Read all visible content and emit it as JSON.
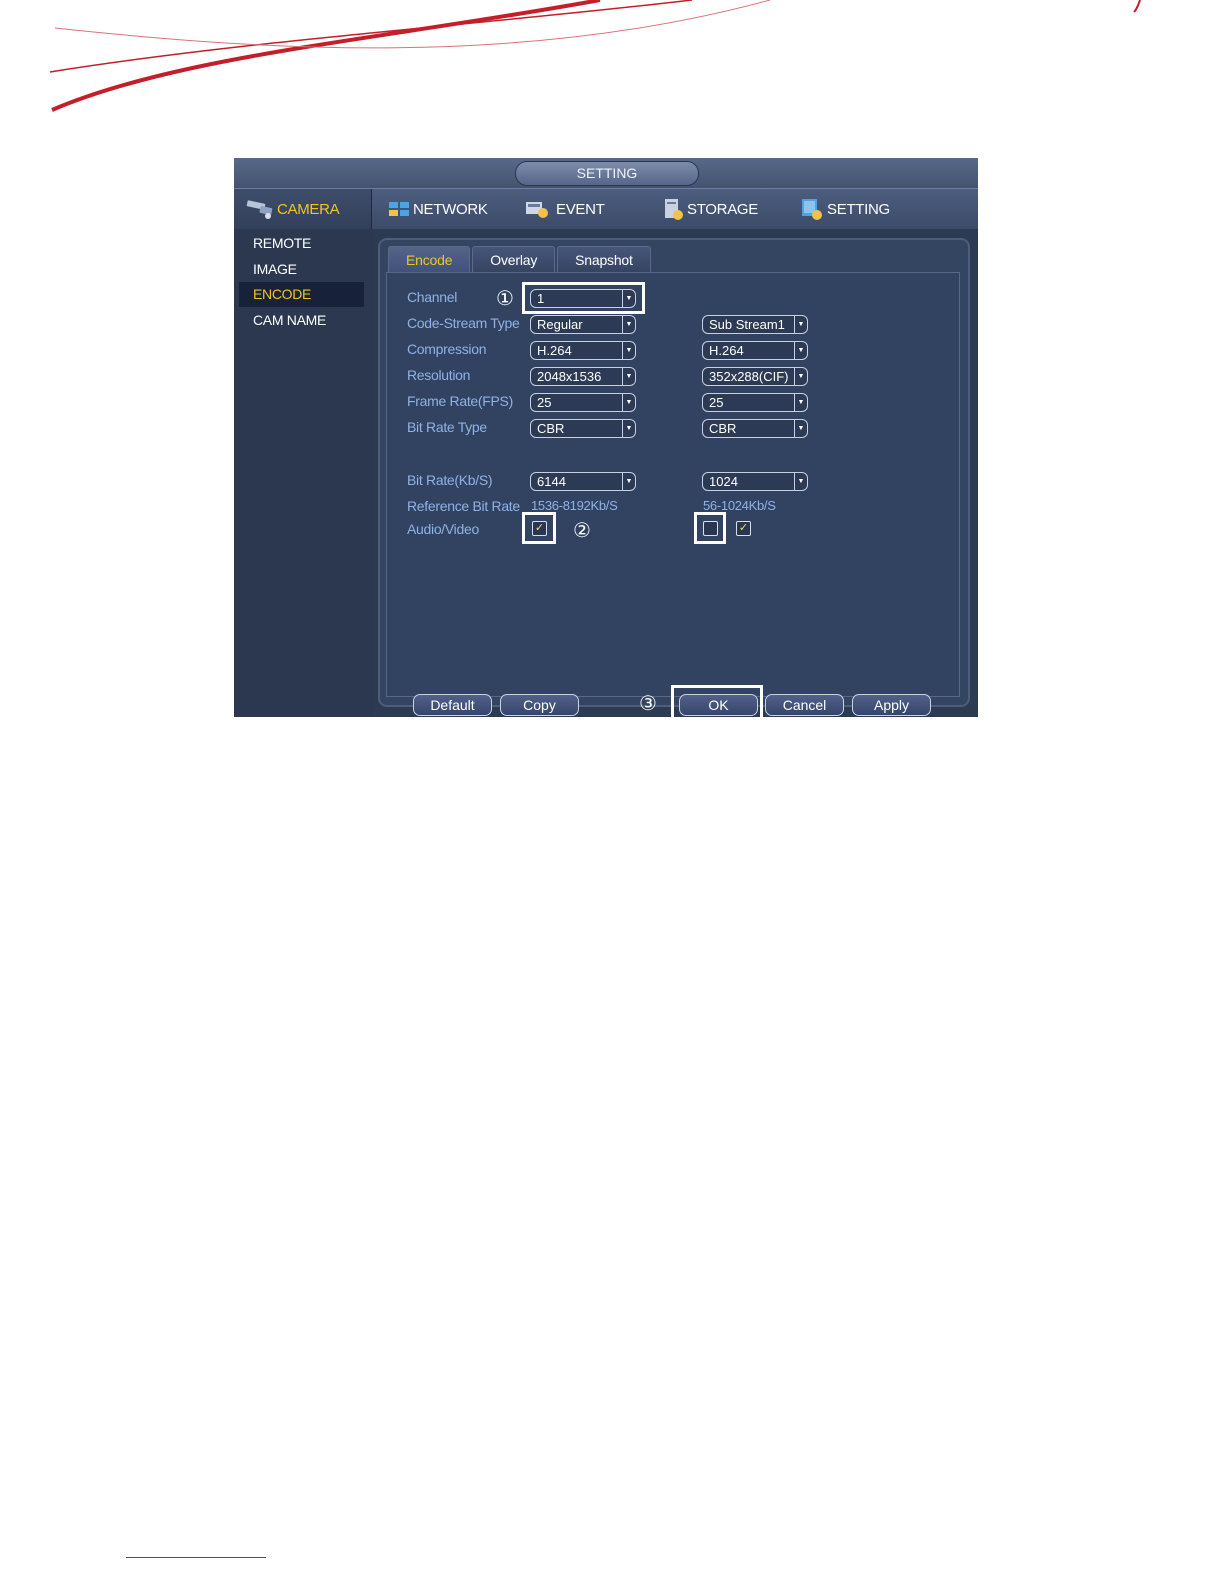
{
  "window": {
    "title": "SETTING"
  },
  "menubar": {
    "items": [
      {
        "label": "CAMERA",
        "icon": "camera-icon",
        "active": true
      },
      {
        "label": "NETWORK",
        "icon": "network-icon"
      },
      {
        "label": "EVENT",
        "icon": "event-icon"
      },
      {
        "label": "STORAGE",
        "icon": "storage-icon"
      },
      {
        "label": "SETTING",
        "icon": "setting-icon"
      }
    ]
  },
  "sidebar": {
    "items": [
      {
        "label": "REMOTE"
      },
      {
        "label": "IMAGE"
      },
      {
        "label": "ENCODE",
        "active": true
      },
      {
        "label": "CAM NAME"
      }
    ]
  },
  "tabs": [
    {
      "label": "Encode",
      "active": true
    },
    {
      "label": "Overlay"
    },
    {
      "label": "Snapshot"
    }
  ],
  "form": {
    "channel": {
      "label": "Channel",
      "value": "1"
    },
    "code_stream": {
      "label": "Code-Stream Type",
      "main": "Regular",
      "sub": "Sub Stream1"
    },
    "compression": {
      "label": "Compression",
      "main": "H.264",
      "sub": "H.264"
    },
    "resolution": {
      "label": "Resolution",
      "main": "2048x1536",
      "sub": "352x288(CIF)"
    },
    "frame_rate": {
      "label": "Frame Rate(FPS)",
      "main": "25",
      "sub": "25"
    },
    "bit_rate_type": {
      "label": "Bit Rate Type",
      "main": "CBR",
      "sub": "CBR"
    },
    "bit_rate": {
      "label": "Bit Rate(Kb/S)",
      "main": "6144",
      "sub": "1024"
    },
    "reference": {
      "label": "Reference Bit Rate",
      "main": "1536-8192Kb/S",
      "sub": "56-1024Kb/S"
    },
    "audio_video": {
      "label": "Audio/Video",
      "main_checked": true,
      "sub_audio_checked": false,
      "sub_video_checked": true
    }
  },
  "buttons": {
    "default": "Default",
    "copy": "Copy",
    "ok": "OK",
    "cancel": "Cancel",
    "apply": "Apply"
  },
  "callouts": {
    "c1": "①",
    "c2": "②",
    "c3": "③"
  },
  "glyphs": {
    "dropdown_arrow": "▼",
    "check": "✓"
  },
  "colors": {
    "accent": "#f3c51c",
    "label": "#8eb2e6",
    "brand_swoosh": "#c41e2a",
    "panel": "#344561"
  }
}
